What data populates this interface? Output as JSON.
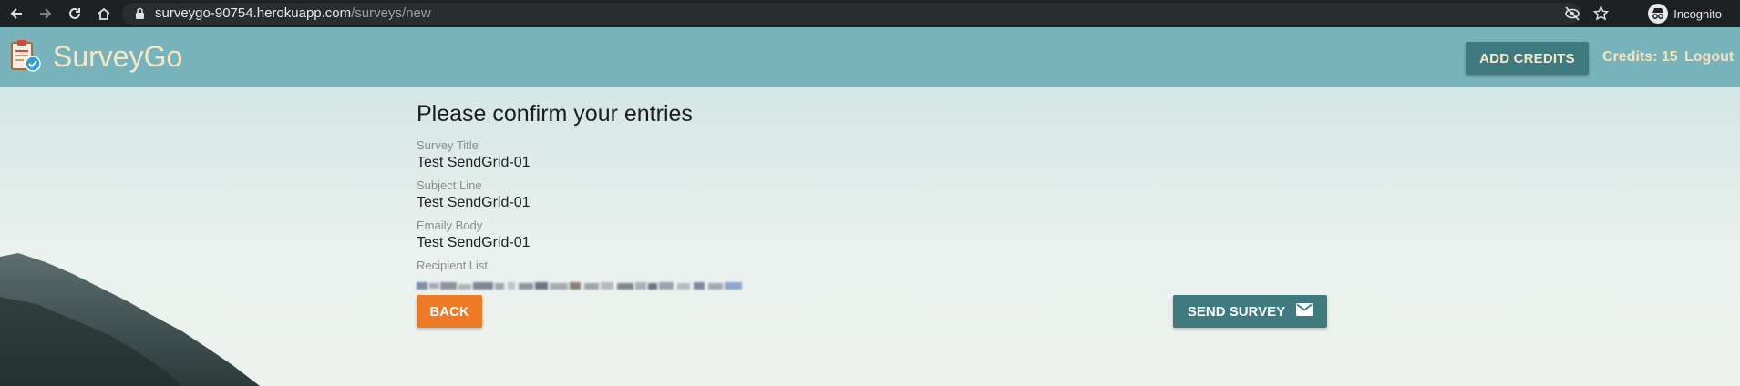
{
  "browser": {
    "url_domain": "surveygo-90754.herokuapp.com",
    "url_path": "/surveys/new",
    "profile_label": "Incognito"
  },
  "header": {
    "brand": "SurveyGo",
    "add_credits_label": "ADD CREDITS",
    "credits_text": "Credits: 15",
    "logout_label": "Logout"
  },
  "form": {
    "heading": "Please confirm your entries",
    "fields": [
      {
        "label": "Survey Title",
        "value": "Test SendGrid-01"
      },
      {
        "label": "Subject Line",
        "value": "Test SendGrid-01"
      },
      {
        "label": "Emaily Body",
        "value": "Test SendGrid-01"
      },
      {
        "label": "Recipient List",
        "value": ""
      }
    ],
    "back_label": "BACK",
    "send_label": "SEND SURVEY"
  },
  "colors": {
    "header_bg": "#78b3bb",
    "brand_text": "#f4e7c6",
    "primary_button": "#3e7a7f",
    "back_button": "#ee7a25"
  },
  "icons": {
    "back": "arrow-left-icon",
    "forward": "arrow-right-icon",
    "reload": "reload-icon",
    "home": "home-icon",
    "lock": "lock-icon",
    "eye_off": "eye-off-icon",
    "star": "star-icon",
    "incognito": "incognito-icon",
    "logo": "clipboard-check-icon",
    "send": "mail-icon"
  }
}
